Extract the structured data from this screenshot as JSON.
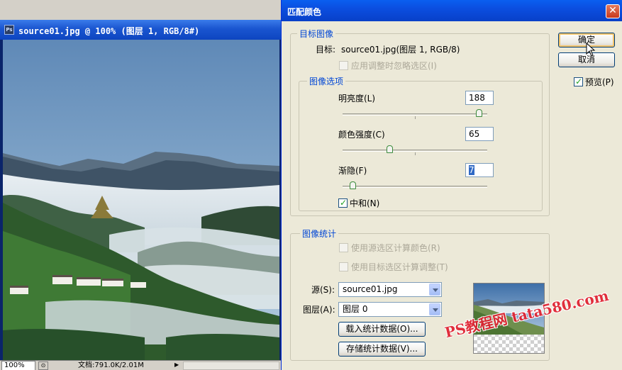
{
  "document_window": {
    "title": "source01.jpg @ 100% (图层 1, RGB/8#)",
    "app_icon": "ps-icon",
    "app_icon_text": "Ps",
    "status": {
      "zoom": "100%",
      "doc_size": "文档:791.0K/2.01M"
    }
  },
  "dialog": {
    "title": "匹配颜色",
    "close_glyph": "✕",
    "ok_label": "确定",
    "cancel_label": "取消",
    "preview_label": "预览(P)",
    "preview_checked": true,
    "target_group": {
      "label": "目标图像",
      "target_prefix": "目标:",
      "target_value": "source01.jpg(图层 1, RGB/8)",
      "ignore_selection_label": "应用调整时忽略选区(I)"
    },
    "image_options": {
      "label": "图像选项",
      "luminance_label": "明亮度(L)",
      "luminance_value": "188",
      "luminance_level": 188,
      "luminance_max": 200,
      "color_intensity_label": "颜色强度(C)",
      "color_intensity_value": "65",
      "color_intensity_level": 65,
      "color_intensity_max": 200,
      "fade_label": "渐隐(F)",
      "fade_value": "7",
      "fade_level": 7,
      "fade_max": 100,
      "neutralize_label": "中和(N)",
      "neutralize_checked": true
    },
    "stats_group": {
      "label": "图像统计",
      "use_source_selection_label": "使用源选区计算颜色(R)",
      "use_target_selection_label": "使用目标选区计算调整(T)",
      "source_label": "源(S):",
      "source_value": "source01.jpg",
      "layer_label": "图层(A):",
      "layer_value": "图层 0",
      "load_stats_label": "载入统计数据(O)...",
      "save_stats_label": "存储统计数据(V)..."
    }
  },
  "watermark": "PS教程网 tata580.com",
  "colors": {
    "title_blue": "#0b4ee0",
    "group_label": "#0046d5",
    "watermark_red": "#e0202f",
    "dialog_bg": "#ece9d8"
  }
}
